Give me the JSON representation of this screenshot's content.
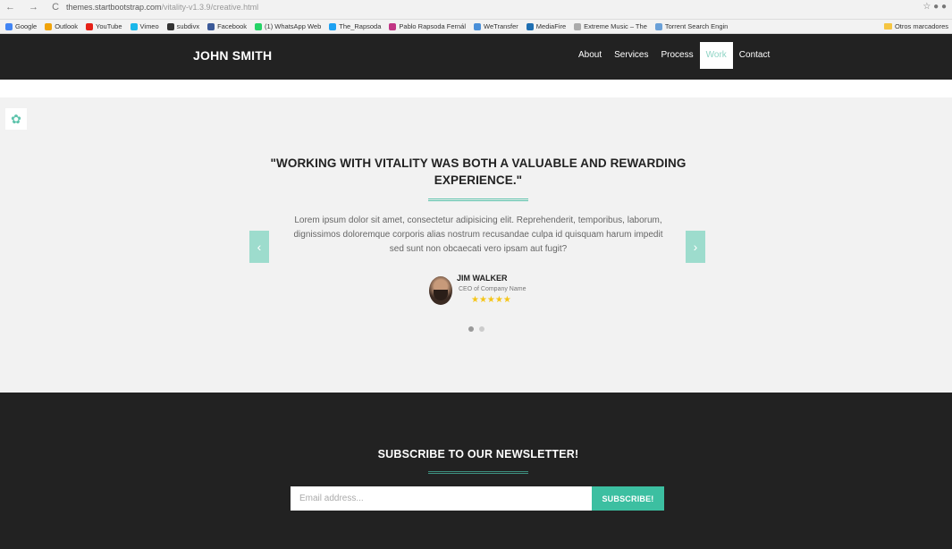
{
  "browser": {
    "nav_glyphs": "← → C",
    "url_host": "themes.startbootstrap.com",
    "url_path": "/vitality-v1.3.9/creative.html",
    "bookmarks": [
      {
        "label": "Google",
        "color": "#4285f4"
      },
      {
        "label": "Outlook",
        "color": "#f0a30a"
      },
      {
        "label": "YouTube",
        "color": "#e62117"
      },
      {
        "label": "Vimeo",
        "color": "#1ab7ea"
      },
      {
        "label": "subdivx",
        "color": "#333333"
      },
      {
        "label": "Facebook",
        "color": "#3b5998"
      },
      {
        "label": "(1) WhatsApp Web",
        "color": "#25d366"
      },
      {
        "label": "The_Rapsoda",
        "color": "#1da1f2"
      },
      {
        "label": "Pablo Rapsoda Fernál",
        "color": "#c13584"
      },
      {
        "label": "WeTransfer",
        "color": "#4a90d9"
      },
      {
        "label": "MediaFire",
        "color": "#1f6fb2"
      },
      {
        "label": "Extreme Music – The",
        "color": "#aaaaaa"
      },
      {
        "label": "Torrent Search Engin",
        "color": "#6aa0d8"
      }
    ],
    "other_bookmarks": "Otros marcadores"
  },
  "nav": {
    "brand": "JOHN SMITH",
    "items": [
      {
        "label": "About",
        "active": false
      },
      {
        "label": "Services",
        "active": false
      },
      {
        "label": "Process",
        "active": false
      },
      {
        "label": "Work",
        "active": true
      },
      {
        "label": "Contact",
        "active": false
      }
    ]
  },
  "testimonial": {
    "settings_icon": "gear-icon",
    "quote": "\"WORKING WITH VITALITY WAS BOTH A VALUABLE AND REWARDING EXPERIENCE.\"",
    "body": "Lorem ipsum dolor sit amet, consectetur adipisicing elit. Reprehenderit, temporibus, laborum, dignissimos doloremque corporis alias nostrum recusandae culpa id quisquam harum impedit sed sunt non obcaecati vero ipsam aut fugit?",
    "prev_icon": "‹",
    "next_icon": "›",
    "author_name": "JIM WALKER",
    "author_role": "CEO of Company Name",
    "rating": 5,
    "stars": "★★★★★",
    "slides_count": 2,
    "active_slide": 0
  },
  "newsletter": {
    "title": "SUBSCRIBE TO OUR NEWSLETTER!",
    "email_placeholder": "Email address...",
    "button_label": "SUBSCRIBE!"
  },
  "colors": {
    "accent": "#5cc3ab",
    "dark": "#222222",
    "light_bg": "#f2f2f2",
    "star": "#f5c518"
  }
}
